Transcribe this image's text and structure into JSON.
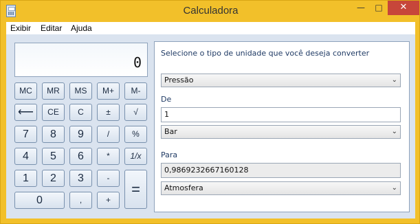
{
  "window": {
    "title": "Calculadora",
    "minimize": "—",
    "maximize": "□",
    "close": "✕"
  },
  "menu": {
    "items": [
      "Exibir",
      "Editar",
      "Ajuda"
    ]
  },
  "display": {
    "value": "0"
  },
  "keys": {
    "mc": "MC",
    "mr": "MR",
    "ms": "MS",
    "mplus": "M+",
    "mminus": "M-",
    "backspace": "⟵",
    "ce": "CE",
    "c": "C",
    "plusminus": "±",
    "sqrt": "√",
    "k7": "7",
    "k8": "8",
    "k9": "9",
    "divide": "/",
    "percent": "%",
    "k4": "4",
    "k5": "5",
    "k6": "6",
    "multiply": "*",
    "reciprocal": "1/x",
    "k1": "1",
    "k2": "2",
    "k3": "3",
    "minus": "-",
    "equals": "=",
    "k0": "0",
    "comma": ",",
    "plus": "+"
  },
  "converter": {
    "prompt": "Selecione o tipo de unidade que você deseja converter",
    "unit_type": "Pressão",
    "from_label": "De",
    "from_value": "1",
    "from_unit": "Bar",
    "to_label": "Para",
    "to_value": "0,9869232667160128",
    "to_unit": "Atmosfera"
  }
}
